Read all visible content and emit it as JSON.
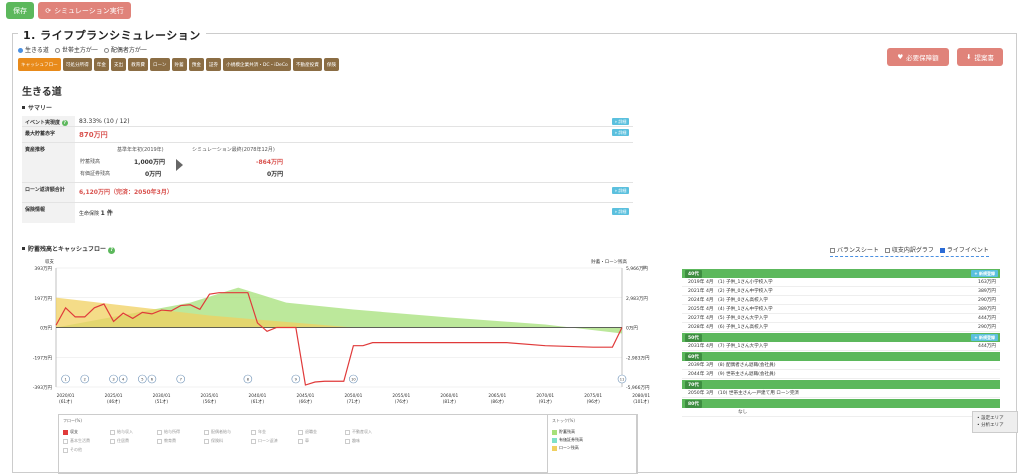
{
  "toolbar": {
    "save": "保存",
    "simulate": "シミュレーション実行"
  },
  "section": {
    "title": "1. ライフプランシミュレーション"
  },
  "person_options": [
    {
      "label": "生きる道",
      "checked": true
    },
    {
      "label": "世帯主方が一",
      "checked": false
    },
    {
      "label": "配偶者方が一",
      "checked": false
    }
  ],
  "tabs": [
    "キャッシュフロー",
    "可処分所得",
    "年金",
    "支出",
    "教育費",
    "ローン",
    "貯蓄",
    "預金",
    "証券",
    "小規模企業共済・DC・iDeCo",
    "不動産投資",
    "保険"
  ],
  "right_buttons": {
    "insurance": "必要保障額",
    "proposal": "提案書"
  },
  "page_title": "生きる道",
  "summary": {
    "heading": "サマリー",
    "detail": "» 詳細",
    "event_label": "イベント実現度",
    "event_value": "83.33% (10 / 12)",
    "max_deposit_label": "最大貯蓄赤字",
    "max_deposit_value": "870万円",
    "asset_label": "資産推移",
    "asset_start": "基準年年初(2019年)",
    "asset_end": "シミュレーション最終(2078年12月)",
    "savings_label": "貯蓄残高",
    "savings_start": "1,000万円",
    "savings_end": "-864万円",
    "securities_label": "有価証券残高",
    "securities_start": "0万円",
    "securities_end": "0万円",
    "loan_label": "ローン返済額合計",
    "loan_value": "6,120万円（完済：2050年3月）",
    "insurance_label": "保険情報",
    "insurance_value_label": "生命保険",
    "insurance_value": "1 件"
  },
  "chart_heading": "貯蓄残高とキャッシュフロー",
  "view_toggles": [
    {
      "label": "バランスシート",
      "checked": false
    },
    {
      "label": "収支内訳グラフ",
      "checked": false
    },
    {
      "label": "ライフイベント",
      "checked": true
    }
  ],
  "chart_data": {
    "type": "line",
    "left_axis_title": "収支",
    "right_axis_title": "貯蓄・ローン残高",
    "left_ticks": [
      "393万円",
      "197万円",
      "0万円",
      "-197万円",
      "-393万円"
    ],
    "right_ticks": [
      "5,966万円",
      "2,983万円",
      "0万円",
      "-2,983万円",
      "-5,966万円"
    ],
    "ylim_left": [
      -393,
      393
    ],
    "ylim_right": [
      -5966,
      5966
    ],
    "xlim": [
      2019,
      2078
    ],
    "x_ticks": [
      {
        "d": "2020/01",
        "a": "(61才)"
      },
      {
        "d": "2025/01",
        "a": "(46才)"
      },
      {
        "d": "2030/01",
        "a": "(51才)"
      },
      {
        "d": "2035/01",
        "a": "(56才)"
      },
      {
        "d": "2040/01",
        "a": "(61才)"
      },
      {
        "d": "2045/01",
        "a": "(66才)"
      },
      {
        "d": "2050/01",
        "a": "(71才)"
      },
      {
        "d": "2055/01",
        "a": "(76才)"
      },
      {
        "d": "2060/01",
        "a": "(81才)"
      },
      {
        "d": "2065/01",
        "a": "(86才)"
      },
      {
        "d": "2070/01",
        "a": "(91才)"
      },
      {
        "d": "2075/01",
        "a": "(96才)"
      },
      {
        "d": "2080/01",
        "a": "(101才)"
      }
    ],
    "event_markers": [
      "1",
      "2",
      "3",
      "4",
      "5",
      "6",
      "7",
      "8",
      "9",
      "10",
      "11"
    ],
    "cashflow": {
      "name": "収支",
      "x": [
        2019,
        2020,
        2021,
        2022,
        2023,
        2024,
        2025,
        2026,
        2027,
        2028,
        2029,
        2030,
        2031,
        2032,
        2033,
        2034,
        2035,
        2036,
        2037,
        2038,
        2039,
        2040,
        2041,
        2042,
        2043,
        2044,
        2045,
        2046,
        2047,
        2048,
        2049,
        2050,
        2051,
        2052,
        2053,
        2054,
        2055,
        2060,
        2065,
        2066,
        2070,
        2075,
        2077,
        2078
      ],
      "y": [
        15,
        130,
        70,
        70,
        130,
        155,
        40,
        95,
        60,
        100,
        90,
        115,
        110,
        145,
        150,
        120,
        220,
        230,
        230,
        230,
        230,
        30,
        -25,
        0,
        0,
        0,
        -380,
        -360,
        -355,
        -355,
        -355,
        -120,
        -120,
        -100,
        -100,
        -100,
        -100,
        -100,
        -100,
        -100,
        -120,
        -130,
        -130,
        0
      ]
    },
    "savings": {
      "name": "貯蓄残高",
      "x": [
        2019,
        2033,
        2038,
        2043,
        2050,
        2060,
        2070,
        2078
      ],
      "y": [
        0,
        2500,
        4000,
        2500,
        1800,
        1000,
        300,
        -600
      ]
    },
    "loan": {
      "name": "ローン残高",
      "x": [
        2019,
        2035,
        2050
      ],
      "y": [
        3000,
        1200,
        0
      ]
    },
    "colors": {
      "cashflow": "#e03a3a",
      "savings": "#a6e07a",
      "loan": "#f0d060"
    }
  },
  "legend": {
    "flow_title": "フロー(%)",
    "stock_title": "ストック(%)",
    "flow_items": [
      "収支",
      "給与収入",
      "給与所得",
      "配偶者給与",
      "年金",
      "退職金",
      "不動産収入",
      "基本生活費",
      "住居費",
      "教育費",
      "保険料",
      "ローン返済",
      "車",
      "趣味",
      "その他"
    ],
    "stock_items": [
      "貯蓄残高",
      "有価証券残高",
      "ローン残高"
    ]
  },
  "life_events": {
    "add_label": "+ 新規登録",
    "groups": [
      {
        "age": "40代",
        "events": [
          {
            "year": "2019年",
            "month": "4月",
            "title": "(1) 子供_1さん小学校入学",
            "amount": "163万円"
          },
          {
            "year": "2021年",
            "month": "4月",
            "title": "(2) 子供_0さん中学校入学",
            "amount": "389万円"
          },
          {
            "year": "2024年",
            "month": "4月",
            "title": "(3) 子供_0さん高校入学",
            "amount": "290万円"
          },
          {
            "year": "2025年",
            "month": "4月",
            "title": "(4) 子供_1さん中学校入学",
            "amount": "389万円"
          },
          {
            "year": "2027年",
            "month": "4月",
            "title": "(5) 子供_0さん大学入学",
            "amount": "444万円"
          },
          {
            "year": "2028年",
            "month": "4月",
            "title": "(6) 子供_1さん高校入学",
            "amount": "290万円"
          }
        ]
      },
      {
        "age": "50代",
        "events": [
          {
            "year": "2031年",
            "month": "4月",
            "title": "(7) 子供_1さん大学入学",
            "amount": "444万円"
          }
        ]
      },
      {
        "age": "60代",
        "events": [
          {
            "year": "2039年",
            "month": "3月",
            "title": "(8) 配偶者さん退職(会社員)",
            "amount": ""
          },
          {
            "year": "2044年",
            "month": "3月",
            "title": "(9) 世帯主さん退職(会社員)",
            "amount": ""
          }
        ]
      },
      {
        "age": "70代",
        "events": [
          {
            "year": "2050年",
            "month": "3月",
            "title": "(10) 世帯主さん一戸建て用 ローン完済",
            "amount": ""
          }
        ]
      },
      {
        "age": "80代",
        "events": [
          {
            "year": "",
            "month": "",
            "title": "なし",
            "amount": ""
          }
        ]
      }
    ]
  },
  "popup": {
    "items": [
      "• 設定エリア",
      "• 分析エリア"
    ]
  }
}
